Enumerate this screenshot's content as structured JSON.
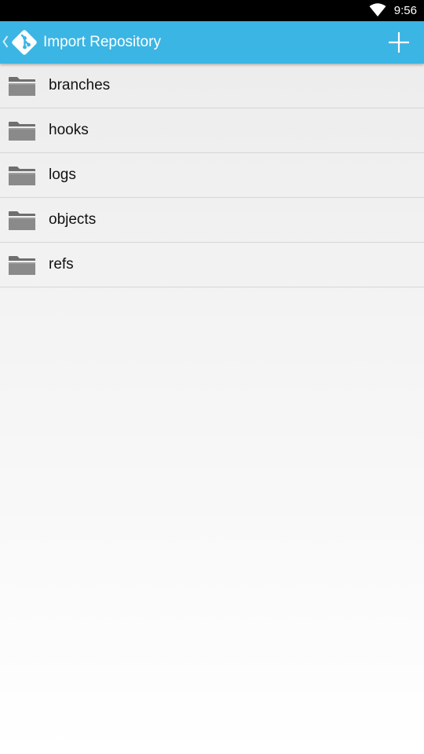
{
  "status_bar": {
    "time": "9:56",
    "wifi_icon": "wifi-icon"
  },
  "action_bar": {
    "title": "Import Repository",
    "up_icon": "chevron-left-icon",
    "logo_icon": "git-logo-icon",
    "add_icon": "plus-icon",
    "color": "#3bb5e3"
  },
  "folders": {
    "icon": "folder-icon",
    "items": [
      {
        "label": "branches"
      },
      {
        "label": "hooks"
      },
      {
        "label": "logs"
      },
      {
        "label": "objects"
      },
      {
        "label": "refs"
      }
    ]
  }
}
